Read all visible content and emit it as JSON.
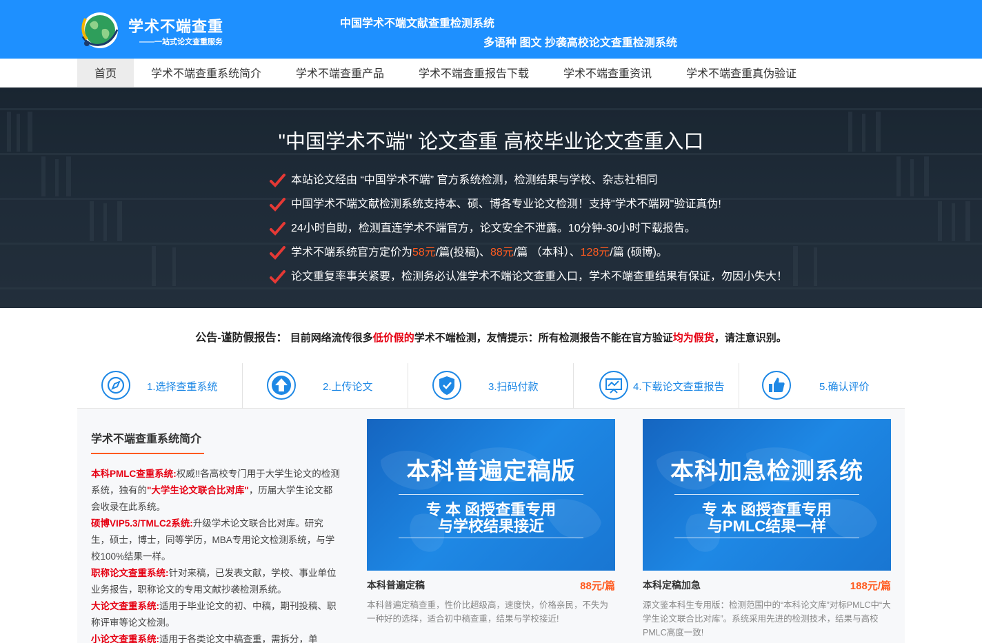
{
  "header": {
    "logo_title": "学术不端查重",
    "logo_subtitle": "——一站式论文查重服务",
    "slogan_line1": "中国学术不端文献查重检测系统",
    "slogan_line2": "多语种 图文 抄袭高校论文查重检测系统",
    "brand_color": "#1e90ff"
  },
  "nav": {
    "items": [
      {
        "label": "首页",
        "active": true
      },
      {
        "label": "学术不端查重系统简介"
      },
      {
        "label": "学术不端查重产品"
      },
      {
        "label": "学术不端查重报告下载"
      },
      {
        "label": "学术不端查重资讯"
      },
      {
        "label": "学术不端查重真伪验证"
      }
    ]
  },
  "hero": {
    "title": "\"中国学术不端\" 论文查重 高校毕业论文查重入口",
    "lines": [
      {
        "text": "本站论文经由 “中国学术不端” 官方系统检测，检测结果与学校、杂志社相同"
      },
      {
        "text": "中国学术不端文献检测系统支持本、硕、博各专业论文检测！支持\"学术不端网\"验证真伪!"
      },
      {
        "text": "24小时自助，检测直连学术不端官方，论文安全不泄露。10分钟-30小时下载报告。"
      },
      {
        "pre": "学术不端系统官方定价为",
        "p1": "58元",
        "m1": "/篇(投稿)、",
        "p2": "88元",
        "m2": "/篇 （本科）、",
        "p3": "128元",
        "m3": "/篇 (硕博)。"
      },
      {
        "text": "论文重复率事关紧要，检测务必认准学术不端论文查重入口，学术不端查重结果有保证，勿因小失大！"
      }
    ],
    "check_color": "#e53935",
    "price_color": "#ff5a1f"
  },
  "notice": {
    "lead": "公告-谨防假报告：",
    "part1": "目前网络流传很多",
    "red1": "低价假的",
    "part2": "学术不端检测，友情提示：所有检测报告不能在官方验证",
    "red2": "均为假货",
    "part3": "，请注意识别。"
  },
  "steps": [
    {
      "label": "1.选择查重系统",
      "icon": "compass-icon"
    },
    {
      "label": "2.上传论文",
      "icon": "upload-arrow-icon"
    },
    {
      "label": "3.扫码付款",
      "icon": "shield-icon"
    },
    {
      "label": "4.下载论文查重报告",
      "icon": "report-chart-icon"
    },
    {
      "label": "5.确认评价",
      "icon": "thumbs-up-icon"
    }
  ],
  "intro": {
    "title": "学术不端查重系统简介",
    "entries": [
      {
        "name": "本科PMLC查重系统:",
        "pre": "权威!!各高校专门用于大学生论文的检测系统，独有的",
        "highlight": "\"大学生论文联合比对库\"",
        "post": "，历届大学生论文都会收录在此系统。"
      },
      {
        "name": "硕博VIP5.3/TMLC2系统:",
        "pre": "升级学术论文联合比对库。研究生，硕士，博士，同等学历，MBA专用论文检测系统，与学校100%结果一样。"
      },
      {
        "name": "职称论文查重系统:",
        "pre": "针对来稿，已发表文献，学校、事业单位业务报告，职称论文的专用文献抄袭检测系统。"
      },
      {
        "name": "大论文查重系统:",
        "pre": "适用于毕业论文的初、中稿，期刊投稿、职称评审等论文检测。"
      },
      {
        "name": "小论文查重系统:",
        "pre": "适用于各类论文中稿查重，需拆分，单"
      }
    ]
  },
  "products": [
    {
      "banner_title": "本科普遍定稿版",
      "banner_sub1": "专 本 函授查重专用",
      "banner_sub2": "与学校结果接近",
      "name": "本科普遍定稿",
      "price": "88元/篇",
      "desc": "本科普遍定稿查重，性价比超级高，速度快，价格亲民，不失为一种好的选择，适合初中稿查重，结果与学校接近!"
    },
    {
      "banner_title": "本科加急检测系统",
      "banner_sub1": "专 本 函授查重专用",
      "banner_sub2": "与PMLC结果一样",
      "name": "本科定稿加急",
      "price": "188元/篇",
      "desc": "源文鉴本科生专用版：检测范围中的“本科论文库”对标PMLC中“大学生论文联合比对库”。系统采用先进的检测技术，结果与高校PMLC高度一致!"
    }
  ]
}
